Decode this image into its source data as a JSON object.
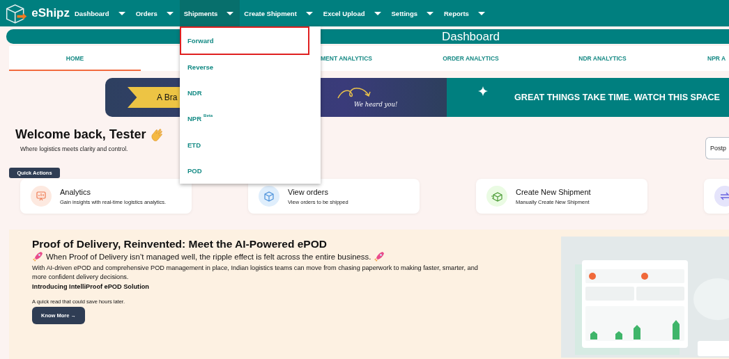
{
  "nav": {
    "logo": "eShipz",
    "menu": [
      {
        "label": "Dashboard",
        "selected": false
      },
      {
        "label": "Orders",
        "selected": false
      },
      {
        "label": "Shipments",
        "selected": true
      },
      {
        "label": "Create Shipment",
        "selected": false
      },
      {
        "label": "Excel Upload",
        "selected": false
      },
      {
        "label": "Settings",
        "selected": false
      },
      {
        "label": "Reports",
        "selected": false
      }
    ]
  },
  "dropdown": {
    "items": [
      {
        "label": "Forward",
        "selected": true
      },
      {
        "label": "Reverse",
        "selected": false
      },
      {
        "label": "NDR",
        "selected": false
      },
      {
        "label": "NPR",
        "badge": "Beta",
        "selected": false
      },
      {
        "label": "ETD",
        "selected": false
      },
      {
        "label": "POD",
        "selected": false
      }
    ]
  },
  "header": {
    "title": "Dashboard"
  },
  "tabs": [
    {
      "label": "HOME",
      "selected": true
    },
    {
      "label": "MENT ANALYTICS",
      "selected": false
    },
    {
      "label": "ORDER ANALYTICS",
      "selected": false
    },
    {
      "label": "NDR ANALYTICS",
      "selected": false
    },
    {
      "label": "NPR A",
      "selected": false
    }
  ],
  "banner": {
    "ribbon": "A Bra",
    "script": "We heard you!",
    "headline": "GREAT THINGS TAKE TIME. WATCH THIS SPACE"
  },
  "welcome": {
    "title": "Welcome back, Tester",
    "subtitle": "Where logistics meets clarity and control.",
    "button": "Postp"
  },
  "quick_actions": {
    "label": "Quick Actions",
    "cards": [
      {
        "kind": "analytics",
        "title": "Analytics",
        "subtitle": "Gain insights with real-time logistics analytics."
      },
      {
        "kind": "orders",
        "title": "View orders",
        "subtitle": "View orders to be shipped"
      },
      {
        "kind": "shipment",
        "title": "Create New Shipment",
        "subtitle": "Manually Create New Shipment"
      },
      {
        "kind": "transfer"
      }
    ]
  },
  "promo": {
    "title": "Proof of Delivery, Reinvented: Meet the AI-Powered ePOD",
    "tagline": "When Proof of Delivery isn’t managed well, the ripple effect is felt across the entire business.",
    "body": "With AI-driven ePOD and comprehensive POD management in place, Indian logistics teams can move from chasing paperwork to making faster, smarter, and more confident delivery decisions.",
    "subheading": "Introducing IntelliProof ePOD Solution",
    "note": "A quick read that could save hours later.",
    "button": "Know More →"
  }
}
